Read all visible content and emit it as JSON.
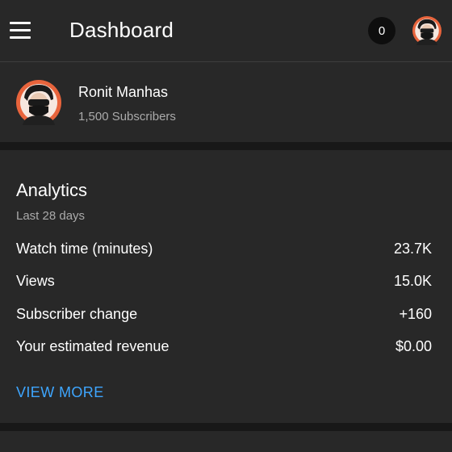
{
  "header": {
    "title": "Dashboard",
    "notification_count": "0",
    "menu_icon": "hamburger-menu-icon",
    "avatar_icon": "avatar-masked-face"
  },
  "channel": {
    "name": "Ronit Manhas",
    "subscribers": "1,500 Subscribers"
  },
  "analytics": {
    "title": "Analytics",
    "period": "Last 28 days",
    "rows": [
      {
        "label": "Watch time (minutes)",
        "value": "23.7K"
      },
      {
        "label": "Views",
        "value": "15.0K"
      },
      {
        "label": "Subscriber change",
        "value": "+160"
      },
      {
        "label": "Your estimated revenue",
        "value": "$0.00"
      }
    ],
    "view_more": "VIEW MORE"
  },
  "colors": {
    "background": "#282828",
    "separator": "#181818",
    "link": "#3ea6ff",
    "secondary_text": "#aaaaaa",
    "avatar_ring": "#e8643c"
  }
}
